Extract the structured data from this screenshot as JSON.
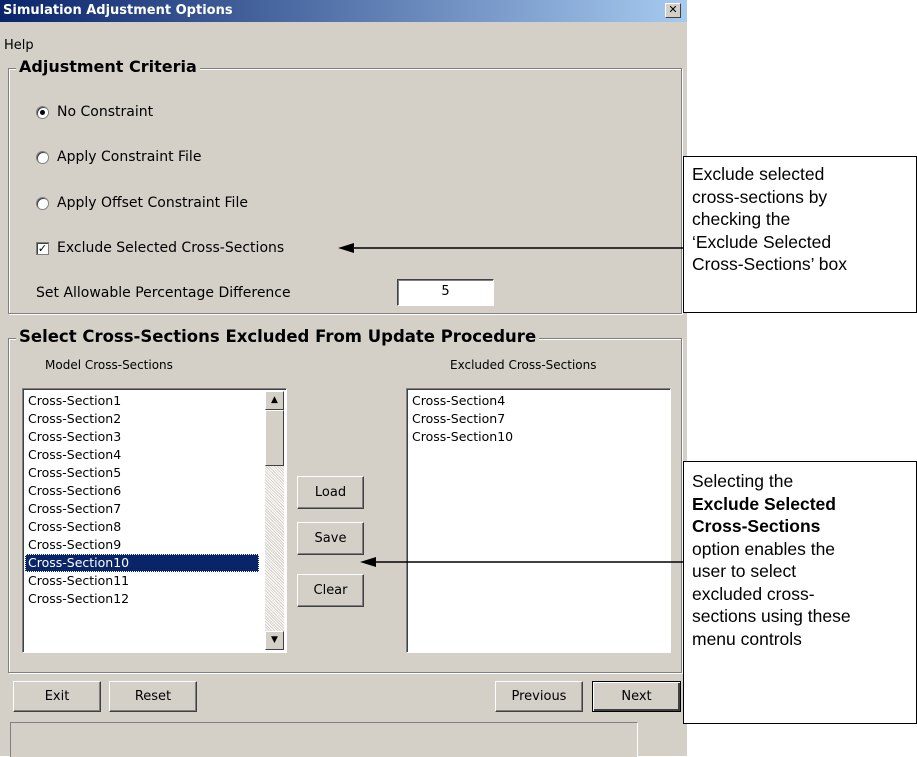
{
  "window": {
    "title": "Simulation Adjustment Options",
    "close_glyph": "✕"
  },
  "menu": {
    "help": "Help"
  },
  "adjustment": {
    "legend": "Adjustment Criteria",
    "options": [
      {
        "label": "No Constraint",
        "selected": true
      },
      {
        "label": "Apply Constraint File",
        "selected": false
      },
      {
        "label": "Apply Offset Constraint File",
        "selected": false
      }
    ],
    "exclude_checkbox": {
      "label": "Exclude Selected Cross-Sections",
      "checked": true,
      "check_glyph": "✓"
    },
    "percentage": {
      "label": "Set Allowable Percentage Difference",
      "value": "5"
    }
  },
  "cross_sections": {
    "legend": "Select Cross-Sections Excluded From Update Procedure",
    "model_label": "Model Cross-Sections",
    "excluded_label": "Excluded Cross-Sections",
    "model_items": [
      "Cross-Section1",
      "Cross-Section2",
      "Cross-Section3",
      "Cross-Section4",
      "Cross-Section5",
      "Cross-Section6",
      "Cross-Section7",
      "Cross-Section8",
      "Cross-Section9",
      "Cross-Section10",
      "Cross-Section11",
      "Cross-Section12"
    ],
    "selected_item": "Cross-Section10",
    "excluded_items": [
      "Cross-Section4",
      "Cross-Section7",
      "Cross-Section10"
    ],
    "buttons": {
      "load": "Load",
      "save": "Save",
      "clear": "Clear"
    }
  },
  "footer": {
    "exit": "Exit",
    "reset": "Reset",
    "previous": "Previous",
    "next": "Next"
  },
  "callouts": {
    "top": [
      "Exclude selected",
      "cross-sections by",
      "checking the",
      "‘Exclude Selected",
      "Cross-Sections’ box"
    ],
    "bottom": {
      "line1": "Selecting the",
      "bold1": "Exclude Selected",
      "bold2": "Cross-Sections",
      "rest": [
        "option enables the",
        "user to select",
        "excluded cross-",
        "sections using these",
        "menu controls"
      ]
    }
  },
  "colors": {
    "titlebar_start": "#0a246a",
    "titlebar_end": "#a6caf0",
    "dialog_bg": "#d4d0c8",
    "selection": "#0a246a"
  }
}
